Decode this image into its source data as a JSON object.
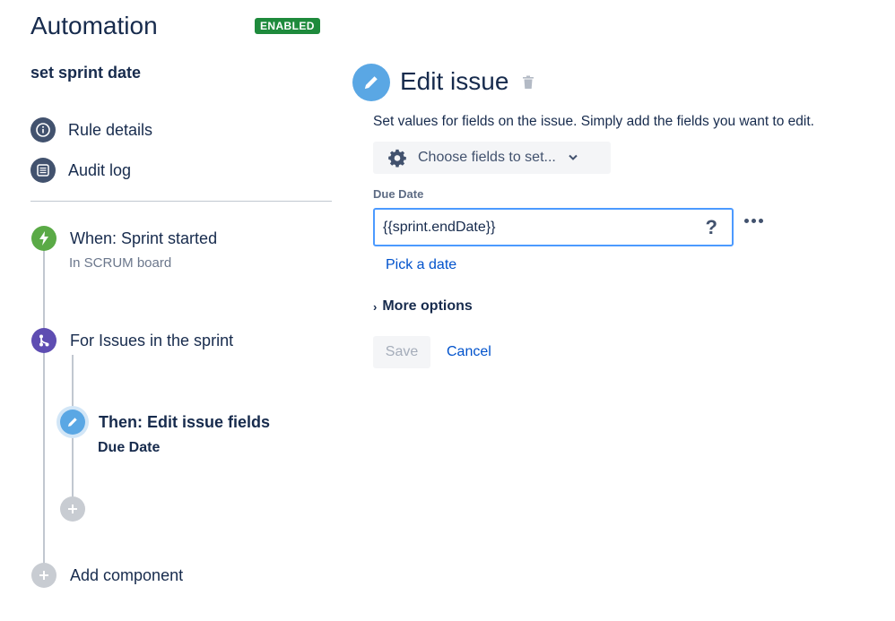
{
  "header": {
    "app_title": "Automation",
    "status_badge": "ENABLED",
    "rule_name": "set sprint date"
  },
  "sidebar": {
    "links": [
      {
        "label": "Rule details",
        "icon": "info-icon"
      },
      {
        "label": "Audit log",
        "icon": "list-icon"
      }
    ]
  },
  "timeline": {
    "trigger": {
      "label": "When: Sprint started",
      "sub": "In SCRUM board",
      "icon": "lightning-icon"
    },
    "branch": {
      "label": "For Issues in the sprint",
      "icon": "branch-icon"
    },
    "action": {
      "label": "Then: Edit issue fields",
      "sub": "Due Date",
      "icon": "pencil-icon"
    },
    "add_component": "Add component"
  },
  "editor": {
    "title": "Edit issue",
    "description": "Set values for fields on the issue. Simply add the fields you want to edit.",
    "choose_fields_label": "Choose fields to set...",
    "field_label": "Due Date",
    "field_value": "{{sprint.endDate}}",
    "help_glyph": "?",
    "pick_date": "Pick a date",
    "more_options": "More options",
    "save": "Save",
    "cancel": "Cancel"
  },
  "colors": {
    "badge": "#1e8a3c",
    "link": "#0052cc",
    "input_focus": "#4c9aff",
    "trigger_node": "#5aaa46",
    "branch_node": "#5e4db2",
    "action_node": "#5aa7e4"
  }
}
